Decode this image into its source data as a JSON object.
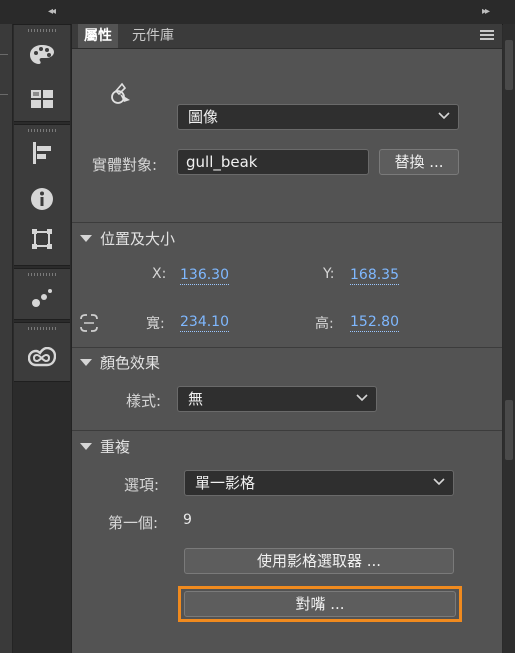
{
  "tabs": {
    "properties": "屬性",
    "library": "元件庫"
  },
  "symbol": {
    "type_value": "圖像",
    "instance_label": "實體對象:",
    "instance_value": "gull_beak",
    "swap_label": "替換 ..."
  },
  "position_size": {
    "title": "位置及大小",
    "x_label": "X:",
    "x_value": "136.30",
    "y_label": "Y:",
    "y_value": "168.35",
    "w_label": "寬:",
    "w_value": "234.10",
    "h_label": "高:",
    "h_value": "152.80"
  },
  "color_effect": {
    "title": "顏色效果",
    "style_label": "樣式:",
    "style_value": "無"
  },
  "loop": {
    "title": "重複",
    "options_label": "選項:",
    "options_value": "單一影格",
    "first_label": "第一個:",
    "first_value": "9",
    "frame_picker_label": "使用影格選取器 ...",
    "lip_sync_label": "對嘴 ..."
  },
  "colors": {
    "panel": "#535353",
    "highlight": "#f08a1e",
    "value_link": "#7fb8ff"
  },
  "icons": [
    "paint-palette-icon",
    "swatches-icon",
    "align-icon",
    "info-icon",
    "transform-icon",
    "motion-presets-icon",
    "creative-cloud-icon",
    "graphic-symbol-icon",
    "link-constraint-icon"
  ]
}
